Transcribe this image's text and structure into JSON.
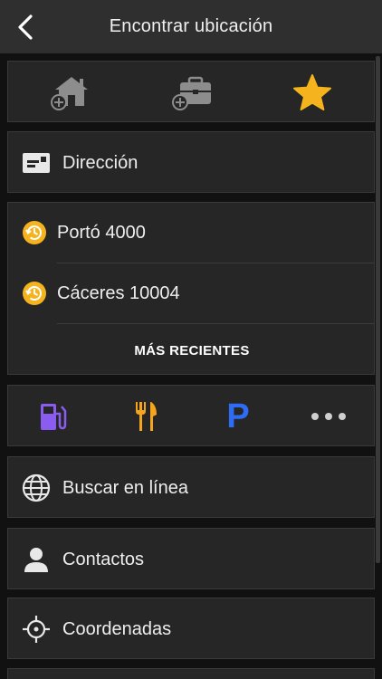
{
  "header": {
    "title": "Encontrar ubicación",
    "back_icon": "chevron-left-icon"
  },
  "quick_access": {
    "items": [
      {
        "name": "add-home",
        "icon": "home-add-icon"
      },
      {
        "name": "add-work",
        "icon": "briefcase-add-icon"
      },
      {
        "name": "favorites",
        "icon": "star-icon",
        "color": "#f5b41d"
      }
    ]
  },
  "address": {
    "label": "Dirección",
    "icon": "envelope-card-icon"
  },
  "recents": {
    "items": [
      {
        "label": "Portó 4000",
        "icon": "history-clock-icon"
      },
      {
        "label": "Cáceres 10004",
        "icon": "history-clock-icon"
      }
    ],
    "more_label": "MÁS RECIENTES",
    "icon_color": "#f5b41d"
  },
  "categories": {
    "items": [
      {
        "name": "fuel",
        "icon": "fuel-station-icon",
        "color": "#8a5cf0"
      },
      {
        "name": "food",
        "icon": "fork-knife-icon",
        "color": "#f5a41d"
      },
      {
        "name": "parking",
        "icon": "parking-icon",
        "color": "#2f6cf5",
        "glyph": "P"
      },
      {
        "name": "more",
        "icon": "more-dots-icon",
        "color": "#cfcfcf"
      }
    ]
  },
  "menu": {
    "search_online": {
      "label": "Buscar en línea",
      "icon": "globe-icon"
    },
    "contacts": {
      "label": "Contactos",
      "icon": "person-icon"
    },
    "coordinates": {
      "label": "Coordenadas",
      "icon": "crosshair-icon"
    }
  }
}
